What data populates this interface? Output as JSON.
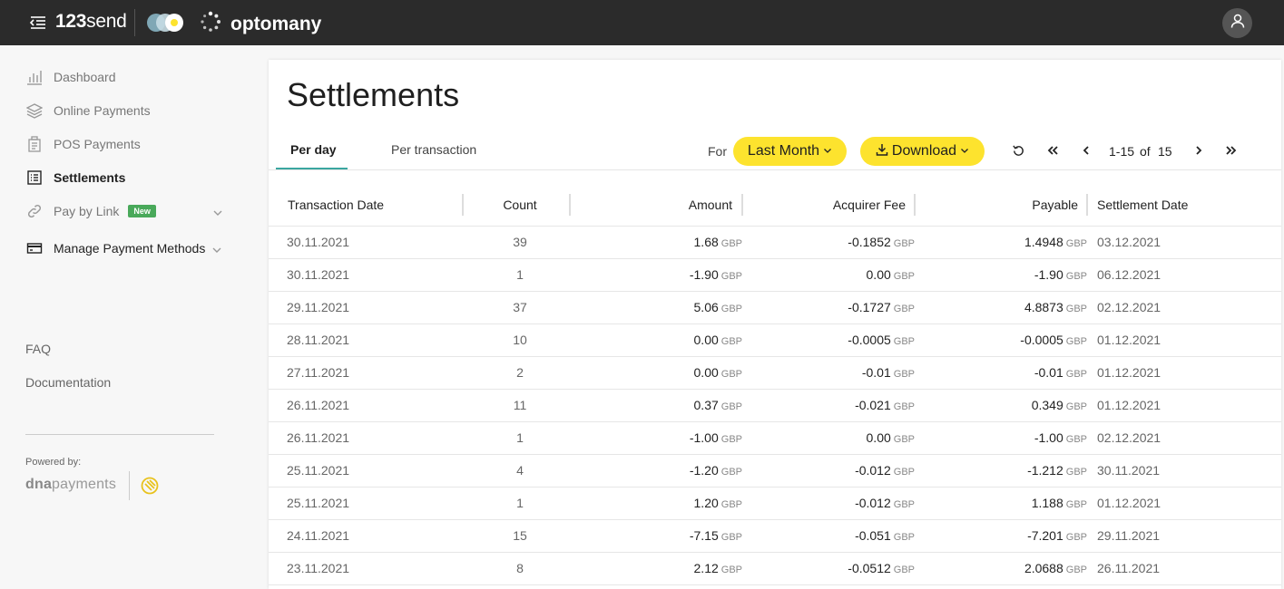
{
  "topbar": {
    "brand_bold": "123",
    "brand_light": "send",
    "company": "optomany"
  },
  "sidebar": {
    "items": [
      {
        "label": "Dashboard",
        "icon": "chart-bars-icon"
      },
      {
        "label": "Online Payments",
        "icon": "layers-icon"
      },
      {
        "label": "POS Payments",
        "icon": "receipt-icon"
      },
      {
        "label": "Settlements",
        "icon": "list-icon",
        "active": true
      },
      {
        "label": "Pay by Link",
        "icon": "link-icon",
        "badge": "New"
      },
      {
        "label": "Manage Payment Methods",
        "icon": "card-icon"
      }
    ],
    "links": [
      "FAQ",
      "Documentation"
    ],
    "powered_by": "Powered by:",
    "dna_bold": "dna",
    "dna_light": "payments"
  },
  "main": {
    "title": "Settlements",
    "tabs": [
      "Per day",
      "Per transaction"
    ],
    "for_label": "For",
    "period": "Last Month",
    "download": "Download",
    "pager": {
      "range": "1-15",
      "of": "of",
      "total": "15"
    },
    "accent": "#fde32e"
  },
  "table": {
    "headers": [
      "Transaction Date",
      "Count",
      "Amount",
      "Acquirer Fee",
      "Payable",
      "Settlement Date"
    ],
    "currency": "GBP",
    "rows": [
      {
        "date": "30.11.2021",
        "count": "39",
        "amount": "1.68",
        "fee": "-0.1852",
        "payable": "1.4948",
        "settled": "03.12.2021"
      },
      {
        "date": "30.11.2021",
        "count": "1",
        "amount": "-1.90",
        "fee": "0.00",
        "payable": "-1.90",
        "settled": "06.12.2021"
      },
      {
        "date": "29.11.2021",
        "count": "37",
        "amount": "5.06",
        "fee": "-0.1727",
        "payable": "4.8873",
        "settled": "02.12.2021"
      },
      {
        "date": "28.11.2021",
        "count": "10",
        "amount": "0.00",
        "fee": "-0.0005",
        "payable": "-0.0005",
        "settled": "01.12.2021"
      },
      {
        "date": "27.11.2021",
        "count": "2",
        "amount": "0.00",
        "fee": "-0.01",
        "payable": "-0.01",
        "settled": "01.12.2021"
      },
      {
        "date": "26.11.2021",
        "count": "11",
        "amount": "0.37",
        "fee": "-0.021",
        "payable": "0.349",
        "settled": "01.12.2021"
      },
      {
        "date": "26.11.2021",
        "count": "1",
        "amount": "-1.00",
        "fee": "0.00",
        "payable": "-1.00",
        "settled": "02.12.2021"
      },
      {
        "date": "25.11.2021",
        "count": "4",
        "amount": "-1.20",
        "fee": "-0.012",
        "payable": "-1.212",
        "settled": "30.11.2021"
      },
      {
        "date": "25.11.2021",
        "count": "1",
        "amount": "1.20",
        "fee": "-0.012",
        "payable": "1.188",
        "settled": "01.12.2021"
      },
      {
        "date": "24.11.2021",
        "count": "15",
        "amount": "-7.15",
        "fee": "-0.051",
        "payable": "-7.201",
        "settled": "29.11.2021"
      },
      {
        "date": "23.11.2021",
        "count": "8",
        "amount": "2.12",
        "fee": "-0.0512",
        "payable": "2.0688",
        "settled": "26.11.2021"
      }
    ]
  }
}
